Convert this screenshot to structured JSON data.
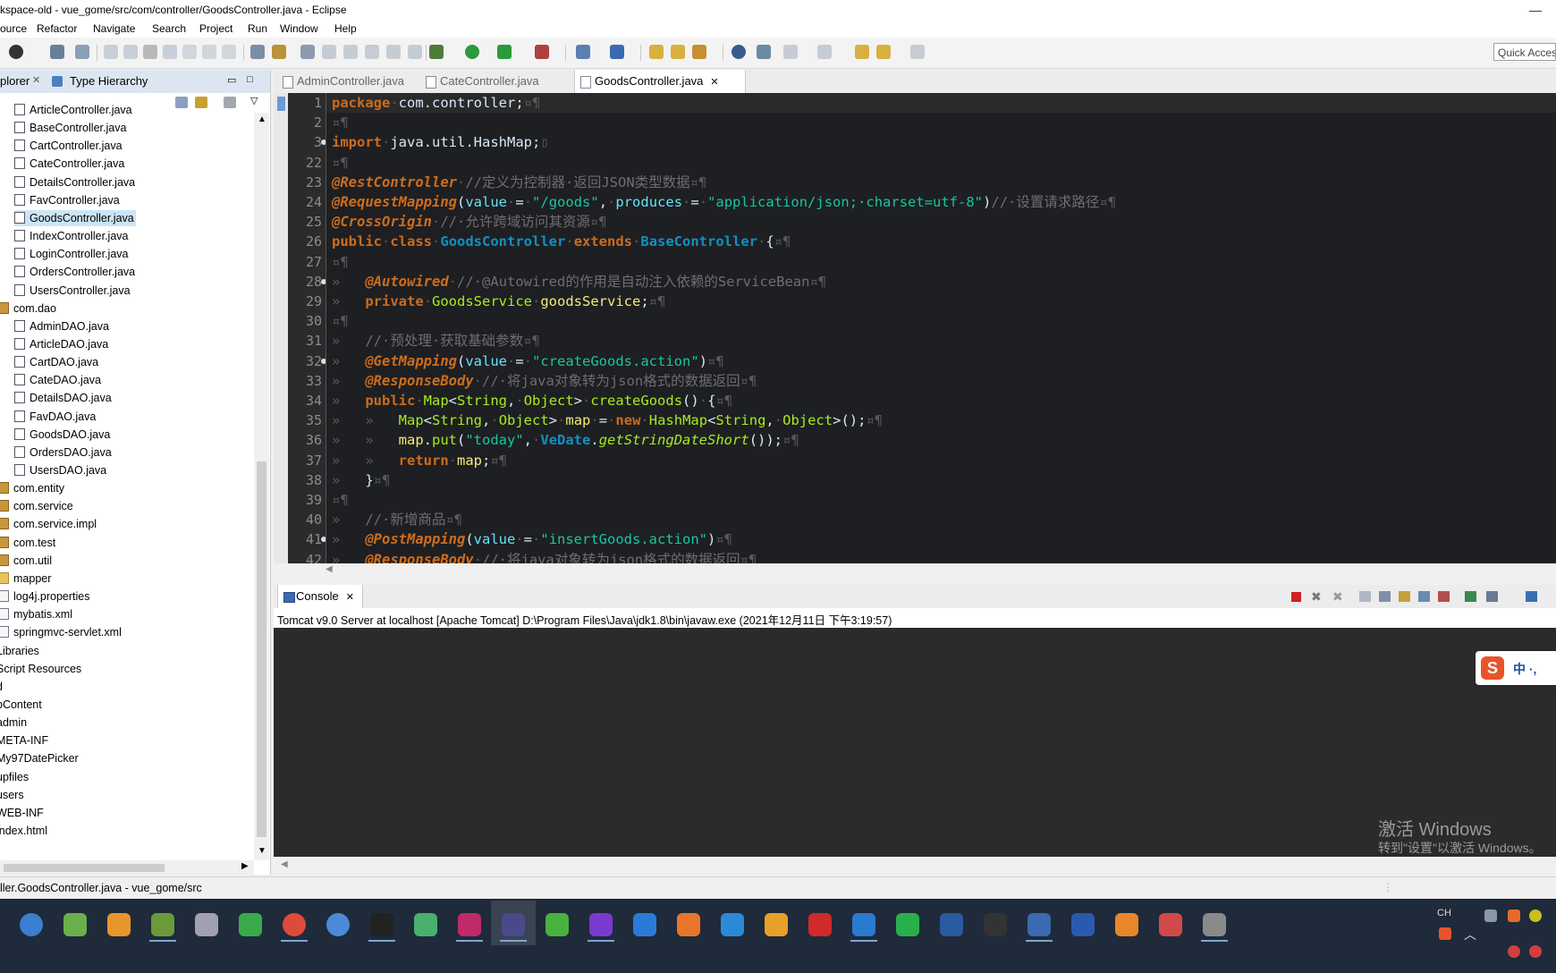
{
  "window": {
    "title": "kspace-old - vue_gome/src/com/controller/GoodsController.java - Eclipse"
  },
  "menu": [
    "ource",
    "Refactor",
    "Navigate",
    "Search",
    "Project",
    "Run",
    "Window",
    "Help"
  ],
  "toolbar": {
    "quick_access": "Quick Acces"
  },
  "left_panel": {
    "tabs": [
      "plorer",
      "Type Hierarchy"
    ],
    "tree": [
      {
        "label": "ArticleController.java",
        "type": "java",
        "indent": 1
      },
      {
        "label": "BaseController.java",
        "type": "java",
        "indent": 1
      },
      {
        "label": "CartController.java",
        "type": "java",
        "indent": 1
      },
      {
        "label": "CateController.java",
        "type": "java",
        "indent": 1
      },
      {
        "label": "DetailsController.java",
        "type": "java",
        "indent": 1
      },
      {
        "label": "FavController.java",
        "type": "java",
        "indent": 1
      },
      {
        "label": "GoodsController.java",
        "type": "java",
        "indent": 1,
        "selected": true
      },
      {
        "label": "IndexController.java",
        "type": "java",
        "indent": 1
      },
      {
        "label": "LoginController.java",
        "type": "java",
        "indent": 1
      },
      {
        "label": "OrdersController.java",
        "type": "java",
        "indent": 1
      },
      {
        "label": "UsersController.java",
        "type": "java",
        "indent": 1
      },
      {
        "label": "com.dao",
        "type": "pkg",
        "indent": 0
      },
      {
        "label": "AdminDAO.java",
        "type": "java",
        "indent": 1
      },
      {
        "label": "ArticleDAO.java",
        "type": "java",
        "indent": 1
      },
      {
        "label": "CartDAO.java",
        "type": "java",
        "indent": 1
      },
      {
        "label": "CateDAO.java",
        "type": "java",
        "indent": 1
      },
      {
        "label": "DetailsDAO.java",
        "type": "java",
        "indent": 1
      },
      {
        "label": "FavDAO.java",
        "type": "java",
        "indent": 1
      },
      {
        "label": "GoodsDAO.java",
        "type": "java",
        "indent": 1
      },
      {
        "label": "OrdersDAO.java",
        "type": "java",
        "indent": 1
      },
      {
        "label": "UsersDAO.java",
        "type": "java",
        "indent": 1
      },
      {
        "label": "com.entity",
        "type": "pkg",
        "indent": 0
      },
      {
        "label": "com.service",
        "type": "pkg",
        "indent": 0
      },
      {
        "label": "com.service.impl",
        "type": "pkg",
        "indent": 0
      },
      {
        "label": "com.test",
        "type": "pkg",
        "indent": 0
      },
      {
        "label": "com.util",
        "type": "pkg",
        "indent": 0
      },
      {
        "label": "mapper",
        "type": "folder",
        "indent": 0
      },
      {
        "label": "log4j.properties",
        "type": "file",
        "indent": 0
      },
      {
        "label": "mybatis.xml",
        "type": "file",
        "indent": 0
      },
      {
        "label": "springmvc-servlet.xml",
        "type": "file",
        "indent": 0
      },
      {
        "label": "Libraries",
        "type": "none",
        "indent": -1
      },
      {
        "label": "Script Resources",
        "type": "none",
        "indent": -1
      },
      {
        "label": "d",
        "type": "none",
        "indent": -1
      },
      {
        "label": "bContent",
        "type": "none",
        "indent": -1
      },
      {
        "label": "admin",
        "type": "none",
        "indent": -1
      },
      {
        "label": "META-INF",
        "type": "none",
        "indent": -1
      },
      {
        "label": "My97DatePicker",
        "type": "none",
        "indent": -1
      },
      {
        "label": "upfiles",
        "type": "none",
        "indent": -1
      },
      {
        "label": "users",
        "type": "none",
        "indent": -1
      },
      {
        "label": "WEB-INF",
        "type": "none",
        "indent": -1
      },
      {
        "label": "index.html",
        "type": "none",
        "indent": -1
      }
    ]
  },
  "editor": {
    "tabs": [
      {
        "label": "AdminController.java",
        "active": false
      },
      {
        "label": "CateController.java",
        "active": false
      },
      {
        "label": "GoodsController.java",
        "active": true
      }
    ],
    "lines": [
      {
        "n": "1",
        "tokens": [
          [
            "kw",
            "package"
          ],
          [
            "ws",
            "·"
          ],
          [
            "plain",
            "com.controller;"
          ],
          [
            "ws",
            "¤¶"
          ]
        ]
      },
      {
        "n": "2",
        "tokens": [
          [
            "ws",
            "¤¶"
          ]
        ]
      },
      {
        "n": "3",
        "bp": true,
        "tokens": [
          [
            "kw",
            "import"
          ],
          [
            "ws",
            "·"
          ],
          [
            "plain",
            "java.util.HashMap;"
          ],
          [
            "ws",
            "▯"
          ]
        ]
      },
      {
        "n": "22",
        "tokens": [
          [
            "ws",
            "¤¶"
          ]
        ]
      },
      {
        "n": "23",
        "tokens": [
          [
            "an",
            "@RestController"
          ],
          [
            "ws",
            "·"
          ],
          [
            "cm",
            "//定义为控制器·返回JSON类型数据"
          ],
          [
            "ws",
            "¤¶"
          ]
        ]
      },
      {
        "n": "24",
        "tokens": [
          [
            "an",
            "@RequestMapping"
          ],
          [
            "plain",
            "("
          ],
          [
            "pr",
            "value"
          ],
          [
            "ws",
            "·"
          ],
          [
            "plain",
            "="
          ],
          [
            "ws",
            "·"
          ],
          [
            "st",
            "\"/goods\""
          ],
          [
            "plain",
            ","
          ],
          [
            "ws",
            "·"
          ],
          [
            "pr",
            "produces"
          ],
          [
            "ws",
            "·"
          ],
          [
            "plain",
            "="
          ],
          [
            "ws",
            "·"
          ],
          [
            "st",
            "\"application/json;·charset=utf-8\""
          ],
          [
            "plain",
            ")"
          ],
          [
            "cm",
            "//·设置请求路径"
          ],
          [
            "ws",
            "¤¶"
          ]
        ]
      },
      {
        "n": "25",
        "tokens": [
          [
            "an",
            "@CrossOrigin"
          ],
          [
            "ws",
            "·"
          ],
          [
            "cm",
            "//·允许跨域访问其资源"
          ],
          [
            "ws",
            "¤¶"
          ]
        ]
      },
      {
        "n": "26",
        "tokens": [
          [
            "kw",
            "public"
          ],
          [
            "ws",
            "·"
          ],
          [
            "kw",
            "class"
          ],
          [
            "ws",
            "·"
          ],
          [
            "ty",
            "GoodsController"
          ],
          [
            "ws",
            "·"
          ],
          [
            "kw",
            "extends"
          ],
          [
            "ws",
            "·"
          ],
          [
            "ty",
            "BaseController"
          ],
          [
            "ws",
            "·"
          ],
          [
            "plain",
            "{"
          ],
          [
            "ws",
            "¤¶"
          ]
        ]
      },
      {
        "n": "27",
        "tokens": [
          [
            "ws",
            "¤¶"
          ]
        ]
      },
      {
        "n": "28",
        "bp": true,
        "tokens": [
          [
            "ws",
            "»   "
          ],
          [
            "an",
            "@Autowired"
          ],
          [
            "ws",
            "·"
          ],
          [
            "cm",
            "//·@Autowired的作用是自动注入依赖的ServiceBean"
          ],
          [
            "ws",
            "¤¶"
          ]
        ]
      },
      {
        "n": "29",
        "tokens": [
          [
            "ws",
            "»   "
          ],
          [
            "kw",
            "private"
          ],
          [
            "ws",
            "·"
          ],
          [
            "fn",
            "GoodsService"
          ],
          [
            "ws",
            "·"
          ],
          [
            "var",
            "goodsService"
          ],
          [
            "plain",
            ";"
          ],
          [
            "ws",
            "¤¶"
          ]
        ]
      },
      {
        "n": "30",
        "tokens": [
          [
            "ws",
            "¤¶"
          ]
        ]
      },
      {
        "n": "31",
        "tokens": [
          [
            "ws",
            "»   "
          ],
          [
            "cm",
            "//·预处理·获取基础参数"
          ],
          [
            "ws",
            "¤¶"
          ]
        ]
      },
      {
        "n": "32",
        "bp": true,
        "tokens": [
          [
            "ws",
            "»   "
          ],
          [
            "an",
            "@GetMapping"
          ],
          [
            "plain",
            "("
          ],
          [
            "pr",
            "value"
          ],
          [
            "ws",
            "·"
          ],
          [
            "plain",
            "="
          ],
          [
            "ws",
            "·"
          ],
          [
            "st",
            "\"createGoods.action\""
          ],
          [
            "plain",
            ")"
          ],
          [
            "ws",
            "¤¶"
          ]
        ]
      },
      {
        "n": "33",
        "tokens": [
          [
            "ws",
            "»   "
          ],
          [
            "an",
            "@ResponseBody"
          ],
          [
            "ws",
            "·"
          ],
          [
            "cm",
            "//·将java对象转为json格式的数据返回"
          ],
          [
            "ws",
            "¤¶"
          ]
        ]
      },
      {
        "n": "34",
        "tokens": [
          [
            "ws",
            "»   "
          ],
          [
            "kw",
            "public"
          ],
          [
            "ws",
            "·"
          ],
          [
            "fn",
            "Map"
          ],
          [
            "plain",
            "<"
          ],
          [
            "fn",
            "String"
          ],
          [
            "plain",
            ","
          ],
          [
            "ws",
            "·"
          ],
          [
            "fn",
            "Object"
          ],
          [
            "plain",
            ">"
          ],
          [
            "ws",
            "·"
          ],
          [
            "fn",
            "createGoods"
          ],
          [
            "plain",
            "()"
          ],
          [
            "ws",
            "·"
          ],
          [
            "plain",
            "{"
          ],
          [
            "ws",
            "¤¶"
          ]
        ]
      },
      {
        "n": "35",
        "tokens": [
          [
            "ws",
            "»   »   "
          ],
          [
            "fn",
            "Map"
          ],
          [
            "plain",
            "<"
          ],
          [
            "fn",
            "String"
          ],
          [
            "plain",
            ","
          ],
          [
            "ws",
            "·"
          ],
          [
            "fn",
            "Object"
          ],
          [
            "plain",
            ">"
          ],
          [
            "ws",
            "·"
          ],
          [
            "var",
            "map"
          ],
          [
            "ws",
            "·"
          ],
          [
            "plain",
            "="
          ],
          [
            "ws",
            "·"
          ],
          [
            "kw",
            "new"
          ],
          [
            "ws",
            "·"
          ],
          [
            "fn",
            "HashMap"
          ],
          [
            "plain",
            "<"
          ],
          [
            "fn",
            "String"
          ],
          [
            "plain",
            ","
          ],
          [
            "ws",
            "·"
          ],
          [
            "fn",
            "Object"
          ],
          [
            "plain",
            ">();"
          ],
          [
            "ws",
            "¤¶"
          ]
        ]
      },
      {
        "n": "36",
        "tokens": [
          [
            "ws",
            "»   »   "
          ],
          [
            "var",
            "map"
          ],
          [
            "plain",
            "."
          ],
          [
            "fn",
            "put"
          ],
          [
            "plain",
            "("
          ],
          [
            "st",
            "\"today\""
          ],
          [
            "plain",
            ","
          ],
          [
            "ws",
            "·"
          ],
          [
            "ty",
            "VeDate"
          ],
          [
            "plain",
            "."
          ],
          [
            "fn",
            "getStringDateShort"
          ],
          [
            "plain",
            "());"
          ],
          [
            "ws",
            "¤¶"
          ]
        ]
      },
      {
        "n": "37",
        "tokens": [
          [
            "ws",
            "»   »   "
          ],
          [
            "kw",
            "return"
          ],
          [
            "ws",
            "·"
          ],
          [
            "var",
            "map"
          ],
          [
            "plain",
            ";"
          ],
          [
            "ws",
            "¤¶"
          ]
        ]
      },
      {
        "n": "38",
        "tokens": [
          [
            "ws",
            "»   "
          ],
          [
            "plain",
            "}"
          ],
          [
            "ws",
            "¤¶"
          ]
        ]
      },
      {
        "n": "39",
        "tokens": [
          [
            "ws",
            "¤¶"
          ]
        ]
      },
      {
        "n": "40",
        "tokens": [
          [
            "ws",
            "»   "
          ],
          [
            "cm",
            "//·新增商品"
          ],
          [
            "ws",
            "¤¶"
          ]
        ]
      },
      {
        "n": "41",
        "bp": true,
        "tokens": [
          [
            "ws",
            "»   "
          ],
          [
            "an",
            "@PostMapping"
          ],
          [
            "plain",
            "("
          ],
          [
            "pr",
            "value"
          ],
          [
            "ws",
            "·"
          ],
          [
            "plain",
            "="
          ],
          [
            "ws",
            "·"
          ],
          [
            "st",
            "\"insertGoods.action\""
          ],
          [
            "plain",
            ")"
          ],
          [
            "ws",
            "¤¶"
          ]
        ]
      },
      {
        "n": "42",
        "tokens": [
          [
            "ws",
            "»   "
          ],
          [
            "an",
            "@ResponseBody"
          ],
          [
            "ws",
            "·"
          ],
          [
            "cm",
            "//·将java对象转为json格式的数据返回"
          ],
          [
            "ws",
            "¤¶"
          ]
        ]
      }
    ]
  },
  "console": {
    "tab": "Console",
    "header": "Tomcat v9.0 Server at localhost [Apache Tomcat] D:\\Program Files\\Java\\jdk1.8\\bin\\javaw.exe (2021年12月11日 下午3:19:57)"
  },
  "status": {
    "text": "ller.GoodsController.java - vue_gome/src"
  },
  "watermark": {
    "line1": "激活 Windows",
    "line2": "转到\"设置\"以激活 Windows。"
  },
  "ime": {
    "text": "中 ·,"
  },
  "taskbar": {
    "icons": [
      "browser-icon",
      "app-green-icon",
      "app-orange-icon",
      "app-tools-icon",
      "app-wrench-icon",
      "wechat-icon",
      "chrome-icon",
      "chrome2-icon",
      "qq-icon",
      "app-leaf-icon",
      "intellij-icon",
      "eclipse-icon",
      "app-green2-icon",
      "visualstudio-icon",
      "app-blue-icon",
      "firefox-icon",
      "edge-icon",
      "app-pinwheel-icon",
      "opera-icon",
      "vscode-icon",
      "hbuilder-icon",
      "powershell-icon",
      "terminal-icon",
      "app-pen-icon",
      "word-icon",
      "app-gear-icon",
      "app-paint-icon",
      "app-editor-icon"
    ],
    "tray_lang": "CH"
  }
}
